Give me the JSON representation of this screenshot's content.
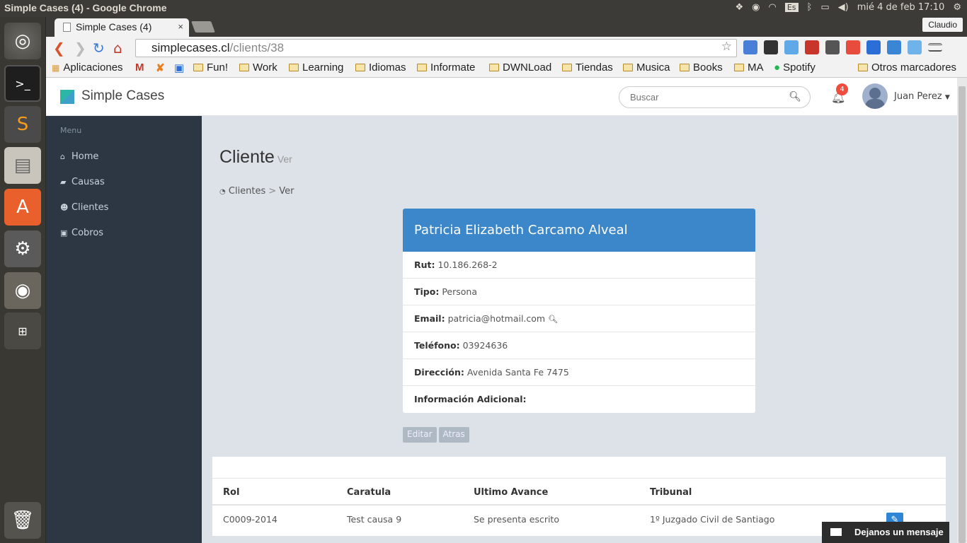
{
  "os": {
    "window_title": "Simple Cases (4) - Google Chrome",
    "lang_badge": "Es",
    "clock": "mié  4 de feb 17:10"
  },
  "browser": {
    "tab_title": "Simple Cases (4)",
    "tab_close": "×",
    "profile_name": "Claudio",
    "url_host": "simplecases.cl",
    "url_path": "/clients/38",
    "bookmarks": [
      "Aplicaciones",
      "Fun!",
      "Work",
      "Learning",
      "Idiomas",
      "Informate",
      "DWNLoad",
      "Tiendas",
      "Musica",
      "Books",
      "MA",
      "Spotify",
      "Otros marcadores"
    ]
  },
  "header": {
    "brand": "Simple Cases",
    "search_placeholder": "Buscar",
    "notifications_count": "4",
    "user_name": "Juan Perez"
  },
  "sidebar": {
    "menu_label": "Menu",
    "items": [
      {
        "label": "Home",
        "icon": "home-icon"
      },
      {
        "label": "Causas",
        "icon": "briefcase-icon"
      },
      {
        "label": "Clientes",
        "icon": "users-icon"
      },
      {
        "label": "Cobros",
        "icon": "money-icon"
      }
    ]
  },
  "main": {
    "title": "Cliente",
    "subtitle": "Ver",
    "breadcrumb": {
      "root": "Clientes",
      "sep": ">",
      "current": "Ver"
    },
    "client": {
      "name": "Patricia Elizabeth Carcamo Alveal",
      "fields": [
        {
          "label": "Rut:",
          "value": "10.186.268-2"
        },
        {
          "label": "Tipo:",
          "value": "Persona"
        },
        {
          "label": "Email:",
          "value": "patricia@hotmail.com"
        },
        {
          "label": "Teléfono:",
          "value": "03924636"
        },
        {
          "label": "Dirección:",
          "value": "Avenida Santa Fe 7475"
        },
        {
          "label": "Información Adicional:",
          "value": ""
        }
      ]
    },
    "buttons": {
      "edit": "Editar",
      "back": "Atras"
    },
    "table": {
      "columns": [
        "Rol",
        "Caratula",
        "Ultimo Avance",
        "Tribunal"
      ],
      "rows": [
        {
          "rol": "C0009-2014",
          "caratula": "Test causa 9",
          "avance": "Se presenta escrito",
          "tribunal": "1º Juzgado Civil de Santiago"
        }
      ]
    }
  },
  "chat_widget": {
    "label": "Dejanos un mensaje"
  }
}
